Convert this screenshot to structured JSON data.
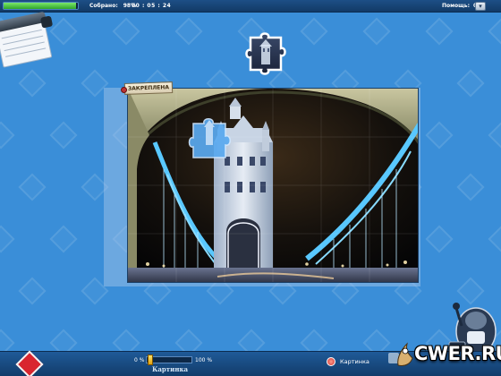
{
  "topbar": {
    "progress_value": 0.98,
    "collected_label": "Собрано:",
    "collected_value": "98%",
    "timer": "00 : 05 : 24",
    "hints_label": "Помощь:",
    "hints_value": "0",
    "dropdown_icon": "chevron-down-icon"
  },
  "board": {
    "pinned_label": "ЗАКРЕПЛЕНА",
    "image_subject": "tower-bridge-night"
  },
  "bottombar": {
    "zoom_min": "0 %",
    "zoom_max": "100 %",
    "zoom_value": 0.05,
    "section_label": "Картинка",
    "picture_button": "Картинка"
  },
  "watermark": {
    "text": "CWER.RU"
  },
  "colors": {
    "background": "#3a8ed8",
    "bar": "#123a66",
    "progress": "#2fa62a"
  }
}
